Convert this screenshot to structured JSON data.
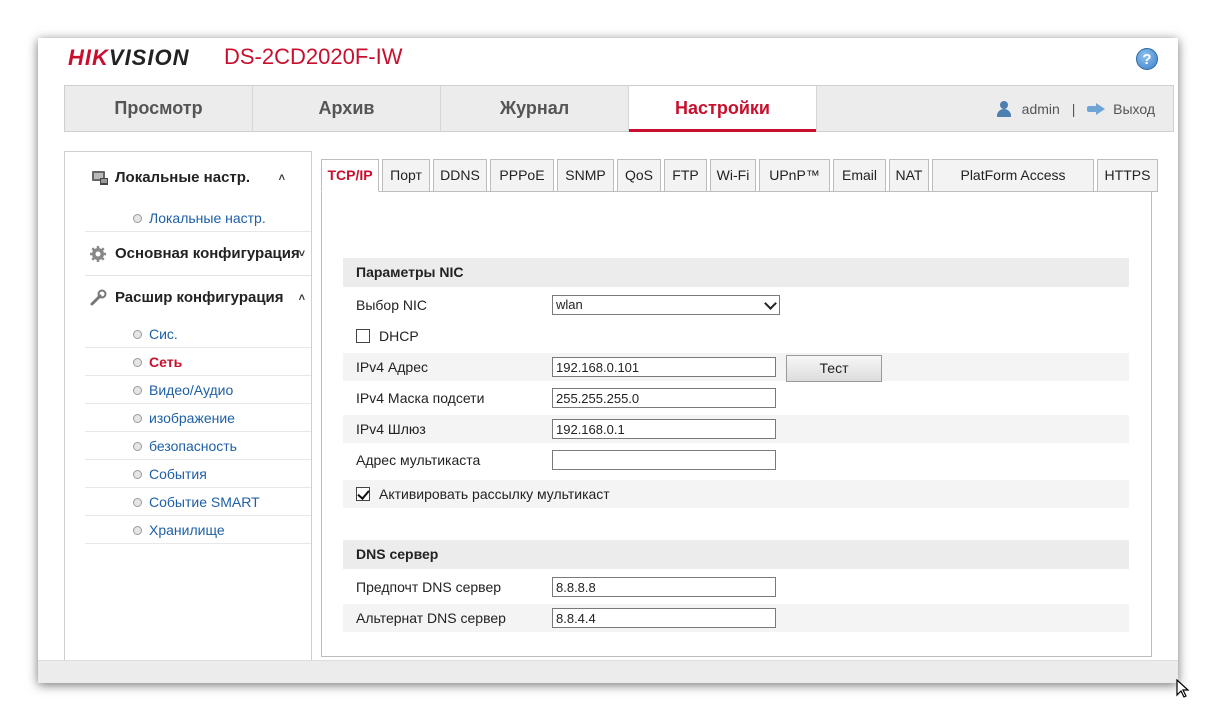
{
  "header": {
    "logo_part1": "HIK",
    "logo_part2": "VISION",
    "model": "DS-2CD2020F-IW",
    "help_icon": "question-icon",
    "help_glyph": "?"
  },
  "nav": {
    "tabs": [
      {
        "label": "Просмотр",
        "active": false
      },
      {
        "label": "Архив",
        "active": false
      },
      {
        "label": "Журнал",
        "active": false
      },
      {
        "label": "Настройки",
        "active": true
      }
    ],
    "user": "admin",
    "separator": "|",
    "logout": "Выход"
  },
  "sidebar": {
    "local_header": "Локальные настр.",
    "local_items": [
      "Локальные настр."
    ],
    "basic_header": "Основная конфигурация",
    "advanced_header": "Расшир конфигурация",
    "advanced_items": [
      {
        "label": "Сис.",
        "active": false
      },
      {
        "label": "Сеть",
        "active": true
      },
      {
        "label": "Видео/Аудио",
        "active": false
      },
      {
        "label": "изображение",
        "active": false
      },
      {
        "label": "безопасность",
        "active": false
      },
      {
        "label": "События",
        "active": false
      },
      {
        "label": "Событие SMART",
        "active": false
      },
      {
        "label": "Хранилище",
        "active": false
      }
    ],
    "chevron_up": "˄",
    "chevron_down": "˅"
  },
  "tabs": [
    {
      "label": "TCP/IP",
      "active": true
    },
    {
      "label": "Порт",
      "active": false
    },
    {
      "label": "DDNS",
      "active": false
    },
    {
      "label": "PPPoE",
      "active": false
    },
    {
      "label": "SNMP",
      "active": false
    },
    {
      "label": "QoS",
      "active": false
    },
    {
      "label": "FTP",
      "active": false
    },
    {
      "label": "Wi-Fi",
      "active": false
    },
    {
      "label": "UPnP™",
      "active": false
    },
    {
      "label": "Email",
      "active": false
    },
    {
      "label": "NAT",
      "active": false
    },
    {
      "label": "PlatForm Access",
      "active": false
    },
    {
      "label": "HTTPS",
      "active": false
    }
  ],
  "nic": {
    "section_title": "Параметры NIC",
    "nic_label": "Выбор NIC",
    "nic_value": "wlan",
    "dhcp_label": "DHCP",
    "dhcp_checked": false,
    "ipv4_label": "IPv4 Адрес",
    "ipv4_value": "192.168.0.101",
    "test_button": "Тест",
    "mask_label": "IPv4 Маска подсети",
    "mask_value": "255.255.255.0",
    "gateway_label": "IPv4 Шлюз",
    "gateway_value": "192.168.0.1",
    "multicast_label": "Адрес мультикаста",
    "multicast_value": "",
    "multicast_enable_label": "Активировать рассылку мультикаст",
    "multicast_enable_checked": true
  },
  "dns": {
    "section_title": "DNS сервер",
    "preferred_label": "Предпочт DNS сервер",
    "preferred_value": "8.8.8.8",
    "alternate_label": "Альтернат DNS сервер",
    "alternate_value": "8.8.4.4"
  },
  "colors": {
    "brand_red": "#c8102e",
    "link_blue": "#1e5fa6"
  }
}
